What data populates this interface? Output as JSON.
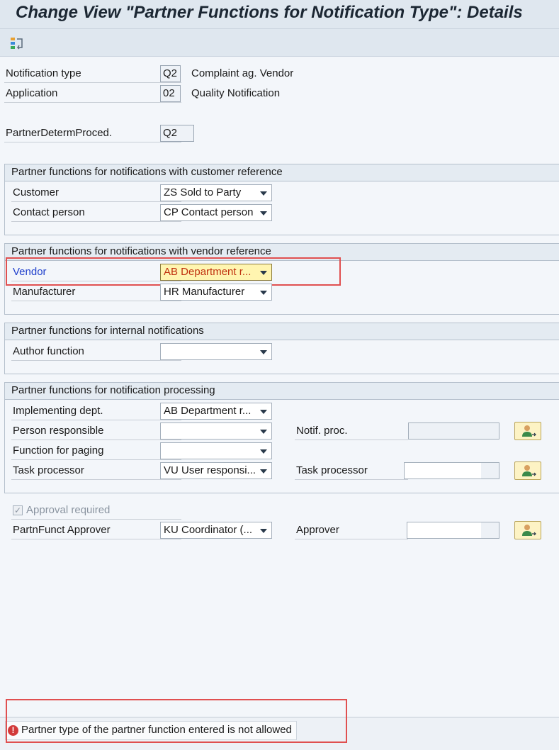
{
  "window": {
    "title": "Change View \"Partner Functions for Notification Type\": Details"
  },
  "toolbar": {
    "icon": "display-change-icon"
  },
  "header": {
    "notification_type": {
      "label": "Notification type",
      "code": "Q2",
      "description": "Complaint ag. Vendor"
    },
    "application": {
      "label": "Application",
      "code": "02",
      "description": "Quality Notification"
    },
    "partner_determ_proced": {
      "label": "PartnerDetermProced.",
      "code": "Q2"
    }
  },
  "groups": {
    "customer": {
      "title": "Partner functions for notifications with customer reference",
      "customer": {
        "label": "Customer",
        "value": "ZS Sold to Party"
      },
      "contact_person": {
        "label": "Contact person",
        "value": "CP Contact person"
      }
    },
    "vendor": {
      "title": "Partner functions for notifications with vendor reference",
      "vendor": {
        "label": "Vendor",
        "value": "AB Department r..."
      },
      "manufacturer": {
        "label": "Manufacturer",
        "value": "HR Manufacturer"
      }
    },
    "internal": {
      "title": "Partner functions for internal notifications",
      "author_function": {
        "label": "Author function",
        "value": ""
      }
    },
    "processing": {
      "title": "Partner functions for notification processing",
      "implementing_dept": {
        "label": "Implementing dept.",
        "value": "AB Department r..."
      },
      "person_responsible": {
        "label": "Person responsible",
        "value": ""
      },
      "function_for_paging": {
        "label": "Function for paging",
        "value": ""
      },
      "task_processor": {
        "label": "Task processor",
        "value": "VU User responsi..."
      },
      "notif_proc_label": "Notif. proc.",
      "task_processor_right_label": "Task processor"
    }
  },
  "approval": {
    "checkbox_label": "Approval required",
    "checked": true,
    "partn_funct_approver": {
      "label": "PartnFunct Approver",
      "value": "KU Coordinator (..."
    },
    "approver_label": "Approver"
  },
  "status_bar": {
    "message": "Partner type of the partner function entered is not allowed",
    "type": "error"
  },
  "colors": {
    "error_highlight": "#e05050",
    "error_field_bg": "#fff5b0",
    "error_text": "#c0310f",
    "link_blue": "#1f3fcc"
  }
}
